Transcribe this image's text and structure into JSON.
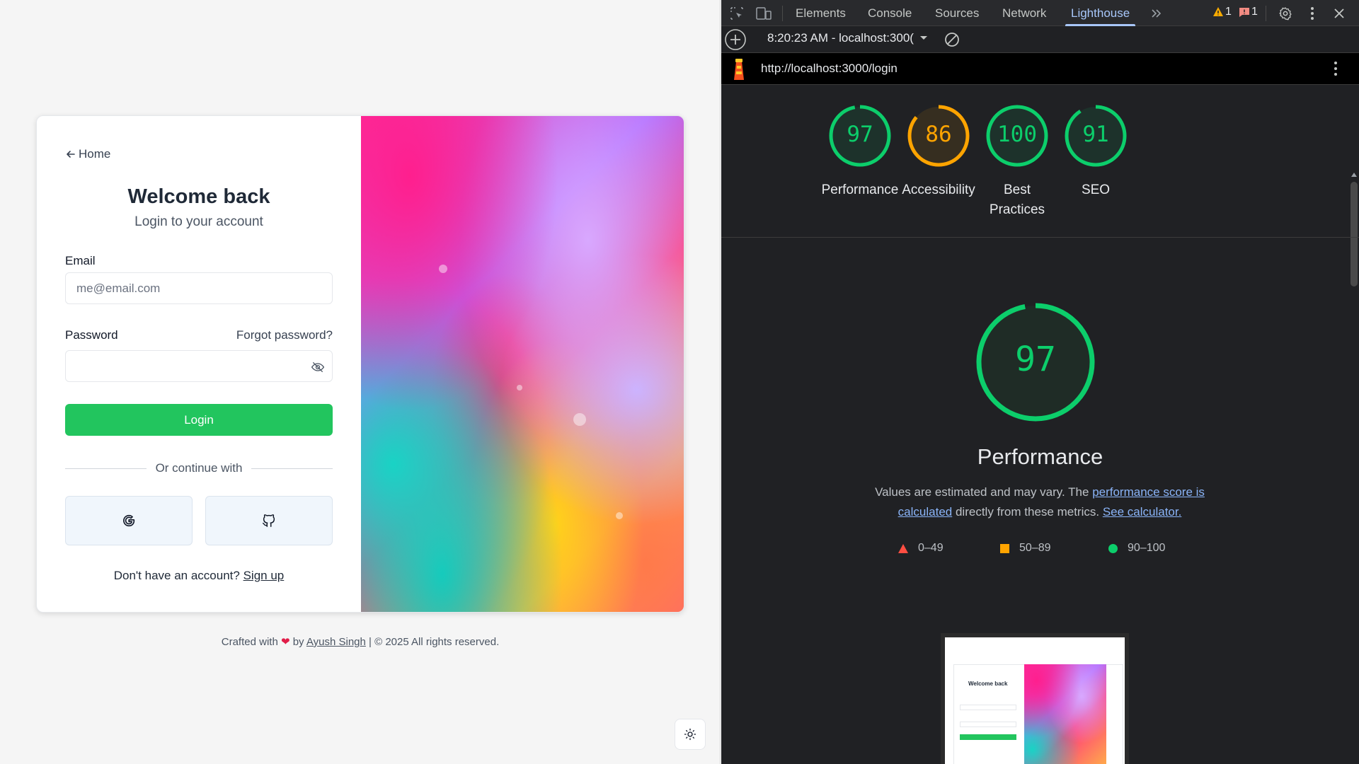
{
  "app": {
    "back_label": "Home",
    "welcome_title": "Welcome back",
    "welcome_subtitle": "Login to your account",
    "email_label": "Email",
    "email_placeholder": "me@email.com",
    "password_label": "Password",
    "forgot_label": "Forgot password?",
    "login_label": "Login",
    "divider_text": "Or continue with",
    "signup_prompt": "Don't have an account?",
    "signup_link": "Sign up",
    "social_buttons": [
      "google-icon",
      "github-icon"
    ]
  },
  "footer": {
    "crafted": "Crafted with",
    "by": "by",
    "author": "Ayush Singh",
    "rights": "| © 2025 All rights reserved."
  },
  "devtools": {
    "tabs": [
      "Elements",
      "Console",
      "Sources",
      "Network",
      "Lighthouse"
    ],
    "active_tab": "Lighthouse",
    "warning_count": "1",
    "error_count": "1",
    "report_select": "8:20:23 AM - localhost:300(",
    "url": "http://localhost:3000/login",
    "scores": [
      {
        "label": "Performance",
        "value": 97,
        "color": "#0cce6b"
      },
      {
        "label": "Accessibility",
        "value": 86,
        "color": "#ffa400"
      },
      {
        "label": "Best Practices",
        "value": 100,
        "color": "#0cce6b"
      },
      {
        "label": "SEO",
        "value": 91,
        "color": "#0cce6b"
      }
    ],
    "main_score": {
      "label": "Performance",
      "value": 97
    },
    "desc_pre": "Values are estimated and may vary. The",
    "desc_link1": "performance score is calculated",
    "desc_mid": "directly from these metrics.",
    "desc_link2": "See calculator.",
    "legend": [
      {
        "label": "0–49",
        "color": "#ff4e42",
        "shape": "triangle"
      },
      {
        "label": "50–89",
        "color": "#ffa400",
        "shape": "square"
      },
      {
        "label": "90–100",
        "color": "#0cce6b",
        "shape": "circle"
      }
    ],
    "thumb_title": "Welcome back"
  }
}
